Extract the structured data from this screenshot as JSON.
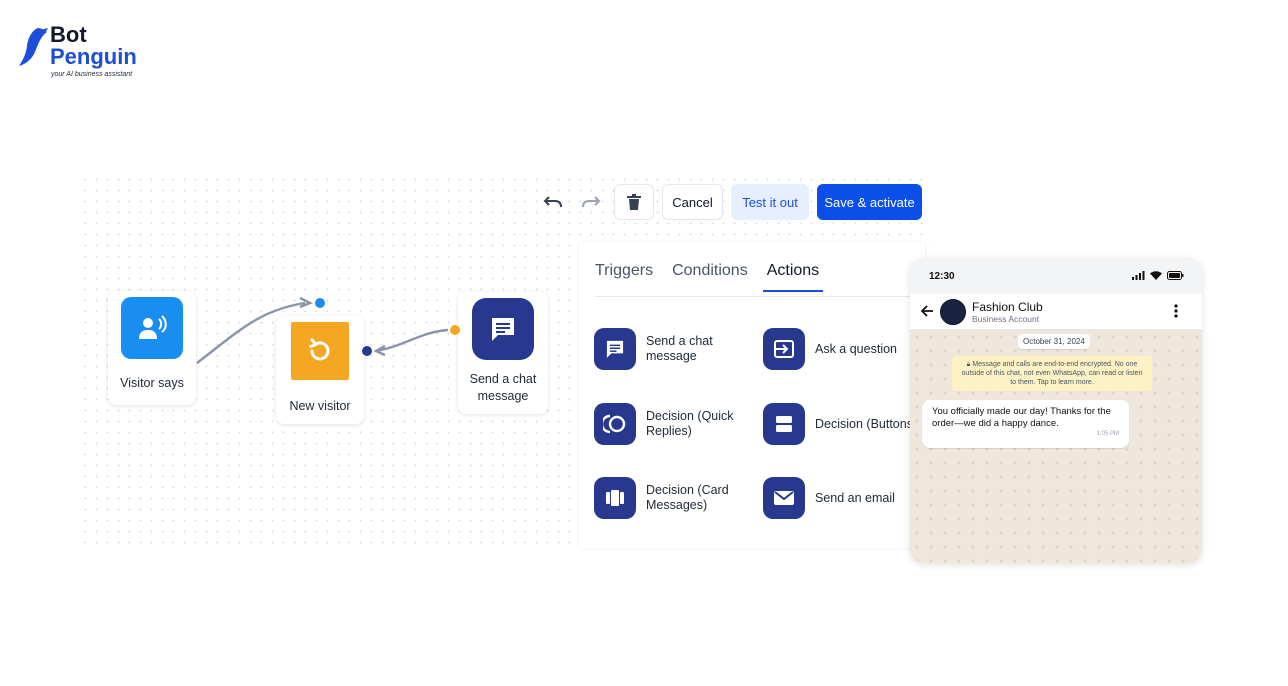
{
  "brand": {
    "name_line1": "Bot",
    "name_line2": "Penguin",
    "tagline": "your AI business assistant",
    "accent_color": "#1d4ed8"
  },
  "toolbar": {
    "undo_icon": "undo-icon",
    "redo_icon": "redo-icon",
    "delete_icon": "trash-icon",
    "cancel_label": "Cancel",
    "test_label": "Test it out",
    "save_label": "Save & activate",
    "save_color": "#0b4fe8"
  },
  "flow": {
    "nodes": [
      {
        "label": "Visitor says",
        "icon": "voice-user-icon",
        "color": "#1a8df0"
      },
      {
        "label": "New visitor",
        "icon": "refresh-icon",
        "color": "#f5a623"
      },
      {
        "label_line1": "Send a chat",
        "label_line2": "message",
        "icon": "chat-message-icon",
        "color": "#28388f"
      }
    ]
  },
  "panel": {
    "tabs": [
      {
        "label": "Triggers",
        "active": false
      },
      {
        "label": "Conditions",
        "active": false
      },
      {
        "label": "Actions",
        "active": true
      }
    ],
    "actions": [
      {
        "label": "Send a chat message",
        "icon": "chat-message-icon"
      },
      {
        "label": "Ask a question",
        "icon": "input-arrow-icon"
      },
      {
        "label": "Decision (Quick Replies)",
        "icon": "quick-replies-icon"
      },
      {
        "label": "Decision (Buttons)",
        "icon": "buttons-icon"
      },
      {
        "label": "Decision (Card Messages)",
        "icon": "cards-icon"
      },
      {
        "label": "Send an email",
        "icon": "email-icon"
      }
    ]
  },
  "phone": {
    "time": "12:30",
    "contact_name": "Fashion Club",
    "contact_subtitle": "Business Account",
    "date_chip": "October 31, 2024",
    "encryption_notice": "Message and calls are end-to-end encrypted. No one outside of this chat, not even WhatsApp, can read or listen to them. Tap to learn more.",
    "message_text": "You officially made our day! Thanks for the order—we did a happy dance.",
    "message_time": "1:05 PM"
  }
}
